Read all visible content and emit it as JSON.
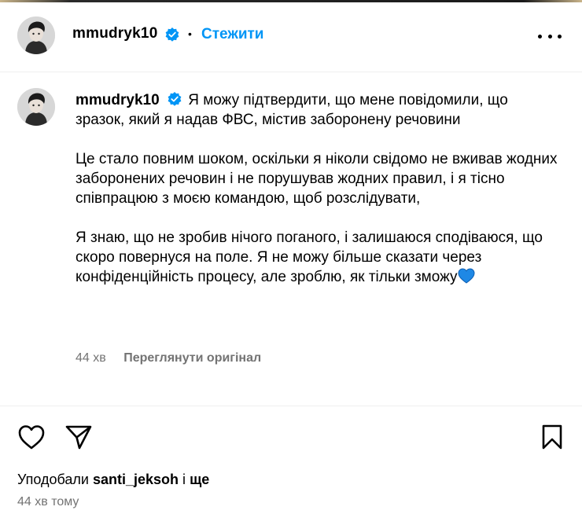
{
  "header": {
    "username": "mmudryk10",
    "separator": "•",
    "follow_label": "Стежити",
    "verified_icon": "verified-badge-icon",
    "more_icon": "more-options-icon"
  },
  "caption": {
    "username": "mmudryk10",
    "paragraph1": "Я можу підтвердити, що мене повідомили, що зразок, який я надав ФВС, містив заборонену речовини",
    "paragraph2": "Це стало повним шоком, оскільки я ніколи свідомо не вживав жодних заборонених речовин і не порушував жодних правил, і я тісно співпрацюю з моєю командою, щоб розслідувати,",
    "paragraph3": "Я знаю, що не зробив нічого поганого, і залишаюся сподіваюся, що скоро повернуся на поле. Я не можу більше сказати через конфіденційність процесу, але зроблю, як тільки зможу",
    "emoji": "blue-heart-icon"
  },
  "meta": {
    "time": "44 хв",
    "see_original": "Переглянути оригінал"
  },
  "actions": {
    "like_icon": "heart-icon",
    "share_icon": "paper-plane-icon",
    "save_icon": "bookmark-icon"
  },
  "likes": {
    "prefix": "Уподобали",
    "user": "santi_jeksoh",
    "joiner": "і",
    "suffix": "ще"
  },
  "footer": {
    "time_ago": "44 хв тому"
  },
  "colors": {
    "accent": "#0095f6",
    "secondary_text": "#737373",
    "divider": "#efefef",
    "heart_blue": "#1e88e5"
  }
}
